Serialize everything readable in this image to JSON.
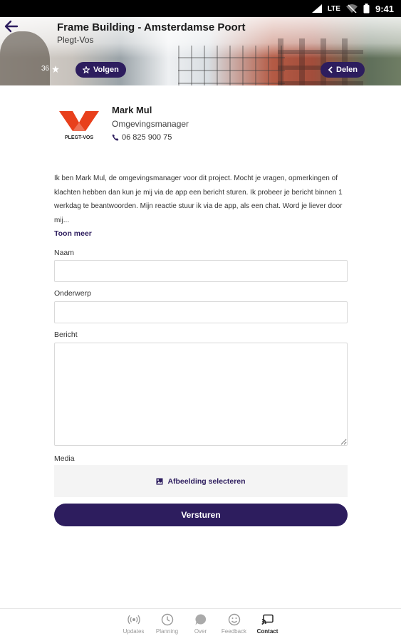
{
  "status_bar": {
    "network": "LTE",
    "time": "9:41"
  },
  "header": {
    "title": "Frame Building - Amsterdamse Poort",
    "subtitle": "Plegt-Vos",
    "rating_count": "36",
    "follow_label": "Volgen",
    "share_label": "Delen"
  },
  "contact": {
    "logo_text": "PLEGT-VOS",
    "name": "Mark Mul",
    "role": "Omgevingsmanager",
    "phone": "06 825 900 75",
    "brand_color": "#e8401c"
  },
  "intro": {
    "text": "Ik ben Mark Mul, de omgevingsmanager voor dit project. Mocht je vragen, opmerkingen of klachten hebben dan kun je mij via de app een bericht sturen. Ik probeer je bericht binnen 1 werkdag te beantwoorden. Mijn reactie stuur ik via de app, als een chat. Word je liever door mij...",
    "more_label": "Toon meer"
  },
  "form": {
    "name_label": "Naam",
    "name_value": "",
    "subject_label": "Onderwerp",
    "subject_value": "",
    "message_label": "Bericht",
    "message_value": "",
    "media_label": "Media",
    "select_image_label": "Afbeelding selecteren",
    "submit_label": "Versturen"
  },
  "nav": {
    "items": [
      {
        "label": "Updates",
        "icon": "broadcast-icon"
      },
      {
        "label": "Planning",
        "icon": "clock-icon"
      },
      {
        "label": "Over",
        "icon": "chat-bubble-icon"
      },
      {
        "label": "Feedback",
        "icon": "smiley-icon"
      },
      {
        "label": "Contact",
        "icon": "cast-screen-icon"
      }
    ],
    "active": "Contact"
  },
  "colors": {
    "accent": "#2d1d5e",
    "status_bar": "#000000"
  }
}
